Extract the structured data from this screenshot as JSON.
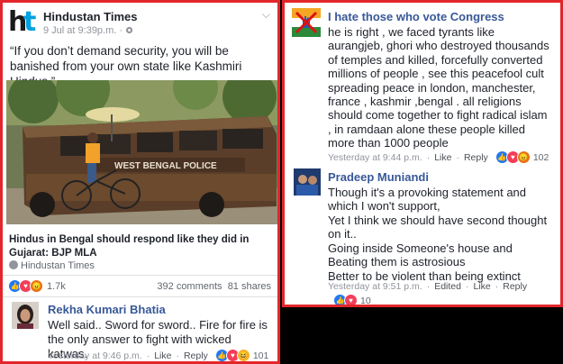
{
  "left_post": {
    "page_name": "Hindustan Times",
    "meta": "9 Jul at 9:39p.m. · ",
    "quote": "“If you don’t demand security, you will be banished from your own state like Kashmiri Hindus.”",
    "link_title": "Hindus in Bengal should respond like they did in Gujarat: BJP MLA",
    "link_source": "Hindustan Times",
    "bus_text": "WEST BENGAL POLICE",
    "reaction_count": "1.7k",
    "comments_count": "392 comments",
    "shares_count": "81 shares",
    "comment": {
      "author": "Rekha Kumari Bhatia",
      "text": "Well said.. Sword for sword.. Fire for fire is the only answer to fight with wicked katwas.",
      "time": "Yesterday at 9:46 p.m.",
      "like": "Like",
      "reply": "Reply",
      "reactions": "101"
    }
  },
  "right_comments": [
    {
      "author": "I hate those who vote Congress",
      "text": "he is right , we faced tyrants like aurangjeb, ghori who destroyed thousands  of temples and killed, forcefully converted millions of people , see this peacefool cult spreading peace in london, manchester, france , kashmir ,bengal . all religions should come together to fight radical islam , in ramdaan alone these people killed more than 1000 people",
      "time": "Yesterday at 9:44 p.m.",
      "like": "Like",
      "reply": "Reply",
      "reactions": "102"
    },
    {
      "author": "Pradeep Muniandi",
      "text_lines": [
        "Though it's a provoking statement and which I won't support,",
        "Yet I think we should have second thought on it..",
        "Going inside Someone's house and Beating them is astrosious",
        "Better to be violent than being extinct"
      ],
      "time": "Yesterday at 9:51 p.m.",
      "edited": "Edited",
      "like": "Like",
      "reply": "Reply",
      "reactions": "10"
    }
  ],
  "colors": {
    "frame": "#e3262b",
    "link_blue": "#385898",
    "meta_gray": "#90949c",
    "ht_blue": "#00a1e0"
  }
}
